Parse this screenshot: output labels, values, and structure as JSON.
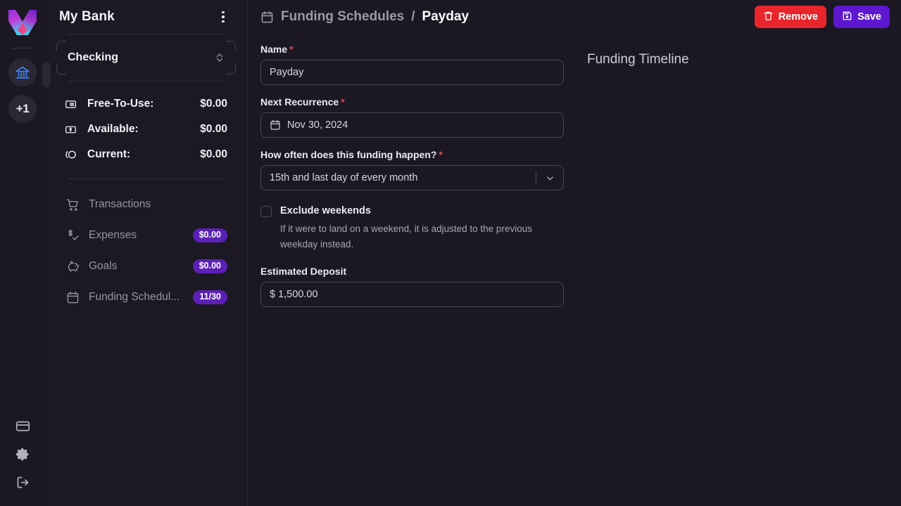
{
  "rail": {
    "logo_name": "app-logo",
    "accounts": [
      {
        "name": "bank-account",
        "type": "bank-icon",
        "active": true
      },
      {
        "name": "add-account",
        "type": "text",
        "label": "+1"
      }
    ],
    "bottom_icons": [
      "credit-card-icon",
      "gear-icon",
      "logout-icon"
    ]
  },
  "sidebar": {
    "title": "My Bank",
    "menu_icon": "kebab-menu-icon",
    "account": {
      "selected": "Checking",
      "chevron": "chevron-up-down-icon"
    },
    "balances": [
      {
        "icon": "free-to-use-icon",
        "label": "Free-To-Use:",
        "amount": "$0.00"
      },
      {
        "icon": "available-icon",
        "label": "Available:",
        "amount": "$0.00"
      },
      {
        "icon": "current-icon",
        "label": "Current:",
        "amount": "$0.00"
      }
    ],
    "nav": [
      {
        "icon": "shopping-cart-icon",
        "label": "Transactions",
        "badge": null
      },
      {
        "icon": "expenses-icon",
        "label": "Expenses",
        "badge": "$0.00"
      },
      {
        "icon": "piggy-bank-icon",
        "label": "Goals",
        "badge": "$0.00"
      },
      {
        "icon": "calendar-icon",
        "label": "Funding Schedul...",
        "badge": "11/30"
      }
    ]
  },
  "topbar": {
    "breadcrumb_icon": "calendar-icon",
    "breadcrumb_parent": "Funding Schedules",
    "breadcrumb_separator": "/",
    "breadcrumb_current": "Payday",
    "remove_label": "Remove",
    "remove_icon": "trash-icon",
    "save_label": "Save",
    "save_icon": "save-disk-icon"
  },
  "form": {
    "name": {
      "label": "Name",
      "required": "*",
      "value": "Payday"
    },
    "next_recurrence": {
      "label": "Next Recurrence",
      "required": "*",
      "value": "Nov 30, 2024",
      "icon": "calendar-icon"
    },
    "frequency": {
      "label": "How often does this funding happen?",
      "required": "*",
      "value": "15th and last day of every month",
      "chevron": "chevron-down-icon"
    },
    "exclude_weekends": {
      "title": "Exclude weekends",
      "description": "If it were to land on a weekend, it is adjusted to the previous weekday instead.",
      "checked": false
    },
    "estimated_deposit": {
      "label": "Estimated Deposit",
      "value": "$ 1,500.00"
    }
  },
  "timeline": {
    "title": "Funding Timeline",
    "entries": []
  },
  "colors": {
    "accent_purple": "#5c17cf",
    "badge_purple": "#5b21b6",
    "danger_red": "#e8252b",
    "required_red": "#e5484d",
    "bg": "#1b1823",
    "sidebar_bg": "#1c1924",
    "bank_icon_blue": "#3b82f6"
  }
}
